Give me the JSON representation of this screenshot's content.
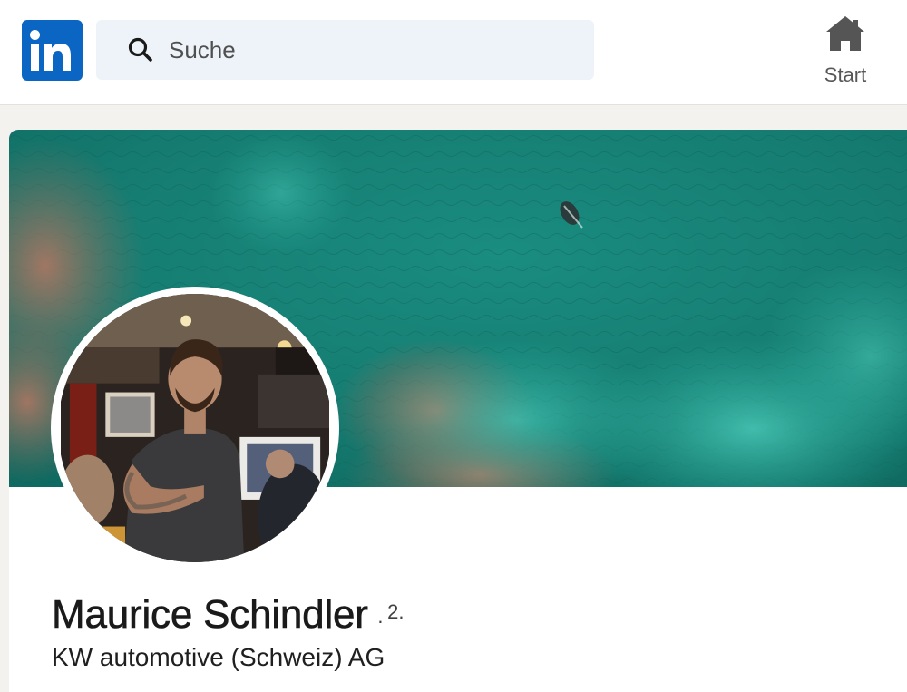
{
  "nav": {
    "logo_label": "in",
    "search": {
      "placeholder": "Suche",
      "value": ""
    },
    "items": [
      {
        "label": "Start",
        "icon": "home-icon"
      }
    ]
  },
  "profile": {
    "name": "Maurice Schindler",
    "degree_separator": "·",
    "connection_degree": "2.",
    "headline": "KW automotive (Schweiz) AG"
  },
  "colors": {
    "brand": "#0a66c2",
    "search_bg": "#edf3f8",
    "page_bg": "#f3f2ef",
    "cover_sea": "#1d8a7e"
  }
}
